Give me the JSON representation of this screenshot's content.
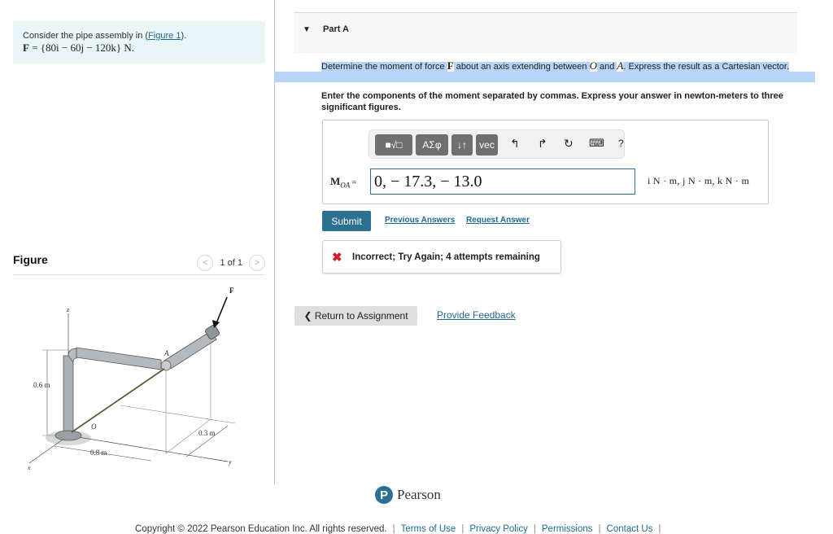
{
  "problem": {
    "intro": "Consider the pipe assembly in (",
    "figure_link": "Figure 1",
    "intro_end": ").",
    "force_label": "F",
    "force_expr": " = {80i − 60j − 120k} N."
  },
  "figure": {
    "title": "Figure",
    "pager": "1 of 1",
    "prev_icon": "chevron-left",
    "next_icon": "chevron-right",
    "labels": {
      "z": "z",
      "x": "x",
      "y": "y",
      "O": "O",
      "A": "A",
      "F": "F",
      "height": "0.6 m",
      "length": "0.8 m",
      "offset": "0.3 m"
    }
  },
  "part": {
    "title": "Part A",
    "question_1": "Determine the moment of force ",
    "question_F": "F",
    "question_2": " about an axis extending between ",
    "question_O": "O",
    "question_3": " and ",
    "question_A": "A",
    "question_4": ". Express the result as a Cartesian vector.",
    "instructions": "Enter the components of the moment separated by commas. Express your answer in newton-meters to three significant figures."
  },
  "toolbar": {
    "templates": "■√□",
    "greek": "ΑΣφ",
    "sort": "↓↑",
    "vec": "vec",
    "undo": "↰",
    "redo": "↱",
    "reset": "↻",
    "keyboard": "⌨",
    "help": "?"
  },
  "answer": {
    "label_main": "M",
    "label_sub": "OA",
    "label_eq": "=",
    "value": "0, − 17.3, − 13.0",
    "units": "i N · m, j N · m, k N · m"
  },
  "actions": {
    "submit": "Submit",
    "previous_answers": "Previous Answers",
    "request_answer": "Request Answer"
  },
  "feedback": {
    "icon": "✖",
    "message": "Incorrect; Try Again; 4 attempts remaining"
  },
  "nav": {
    "return": "❮ Return to Assignment",
    "provide_feedback": "Provide Feedback"
  },
  "brand": {
    "logo_letter": "P",
    "name": "Pearson"
  },
  "footer": {
    "copyright": "Copyright © 2022 Pearson Education Inc. All rights reserved.",
    "links": [
      "Terms of Use",
      "Privacy Policy",
      "Permissions",
      "Contact Us"
    ]
  },
  "colors": {
    "accent": "#2c7192",
    "link": "#1c6a93",
    "error": "#d0202a",
    "highlight": "#b8d5f7",
    "problem_bg": "#e9f5f6"
  }
}
